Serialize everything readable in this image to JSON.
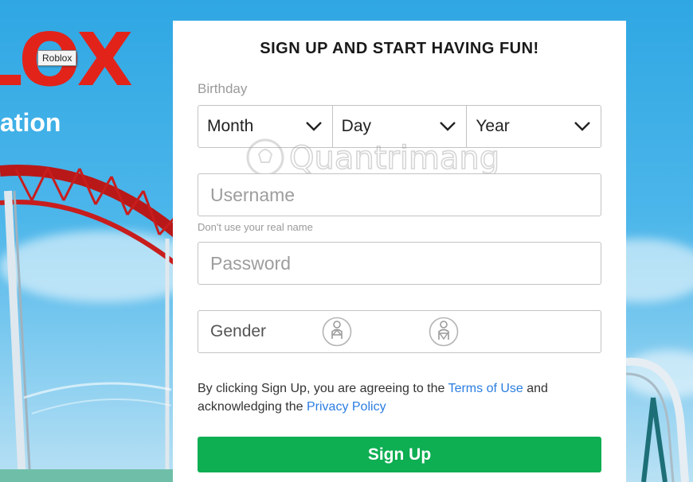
{
  "background": {
    "logo_text": "LOX",
    "tooltip": "Roblox",
    "subtitle": "ation"
  },
  "form": {
    "title": "SIGN UP AND START HAVING FUN!",
    "birthday_label": "Birthday",
    "month": "Month",
    "day": "Day",
    "year": "Year",
    "username_placeholder": "Username",
    "username_hint": "Don't use your real name",
    "password_placeholder": "Password",
    "gender_label": "Gender",
    "gender_options": [
      "male-icon",
      "female-icon"
    ],
    "terms": {
      "prefix": "By clicking Sign Up, you are agreeing to the ",
      "terms_link": "Terms of Use",
      "middle": " and acknowledging the ",
      "privacy_link": "Privacy Policy"
    },
    "signup_label": "Sign Up"
  },
  "watermark": "Quantrimang",
  "colors": {
    "sky": "#2fa7e3",
    "logo_red": "#e2231a",
    "signup_green": "#0eae52",
    "link_blue": "#2b7de1"
  }
}
